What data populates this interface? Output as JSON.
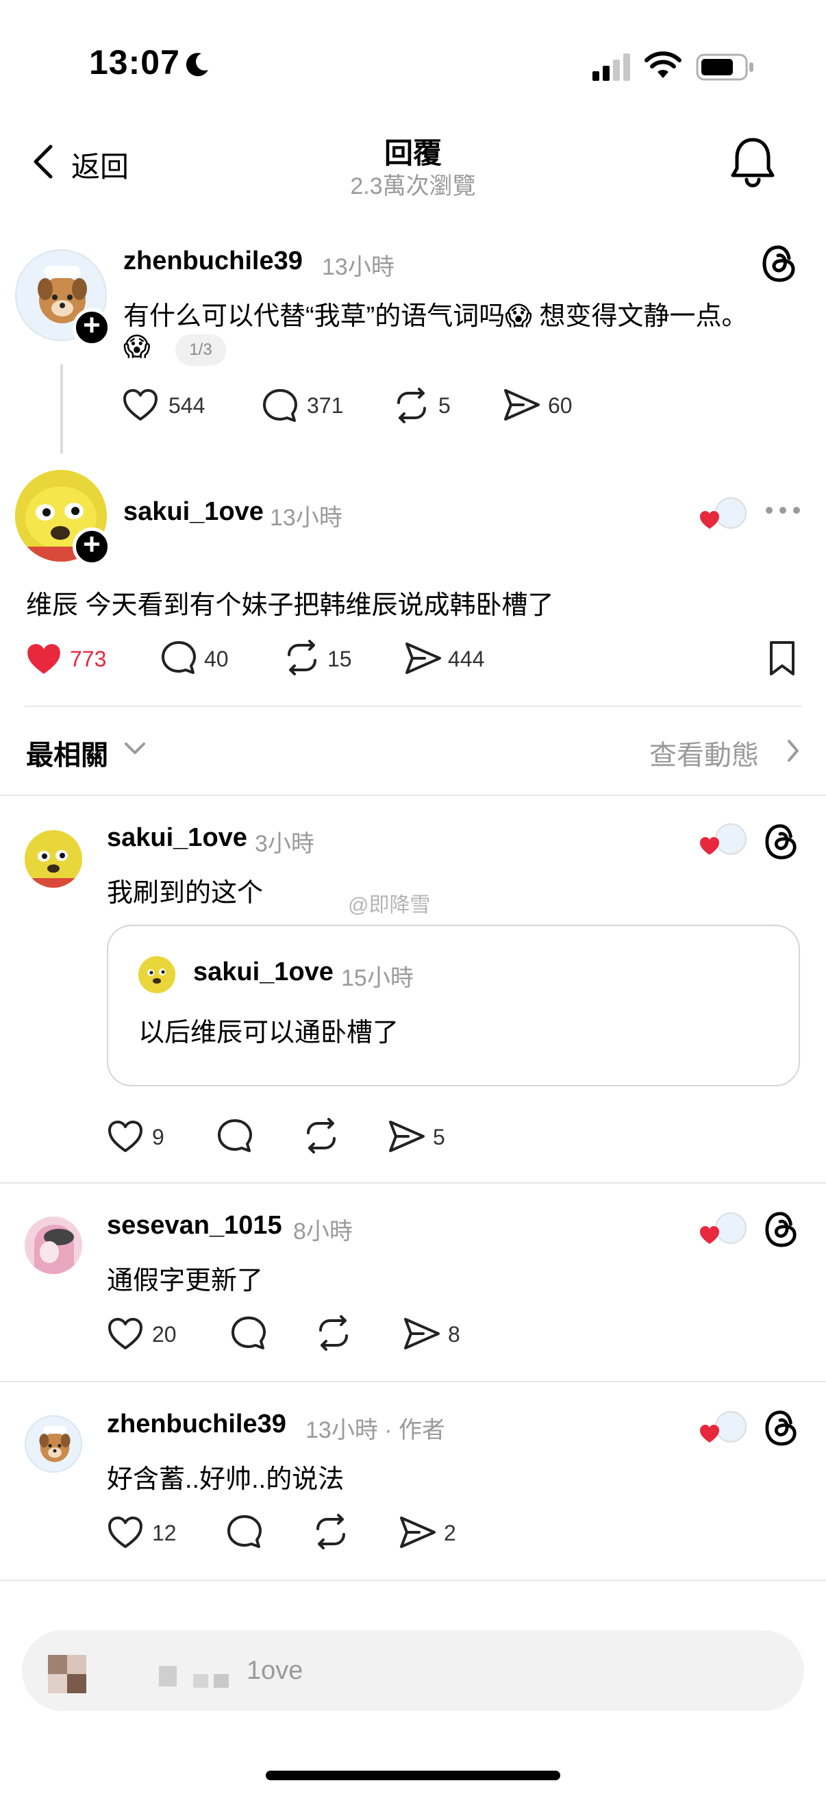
{
  "status_bar": {
    "time": "13:07"
  },
  "header": {
    "back_label": "返回",
    "title": "回覆",
    "subtitle": "2.3萬次瀏覽"
  },
  "original_post": {
    "username": "zhenbuchile39",
    "time": "13小時",
    "text_line1": "有什么可以代替“我草”的语气词吗😱 想变得文静一点。",
    "text_line2_emoji": "😱",
    "page_indicator": "1/3",
    "likes": "544",
    "comments": "371",
    "reposts": "5",
    "shares": "60"
  },
  "main_reply": {
    "username": "sakui_1ove",
    "time": "13小時",
    "text": "维辰 今天看到有个妹子把韩维辰说成韩卧槽了",
    "likes": "773",
    "comments": "40",
    "reposts": "15",
    "shares": "444",
    "liked": true
  },
  "sort_bar": {
    "sort_label": "最相關",
    "activity_label": "查看動態"
  },
  "comments": [
    {
      "username": "sakui_1ove",
      "time": "3小時",
      "text": "我刷到的这个",
      "likes": "9",
      "shares": "5",
      "quote": {
        "username": "sakui_1ove",
        "time": "15小時",
        "text": "以后维辰可以通卧槽了"
      }
    },
    {
      "username": "sesevan_1015",
      "time": "8小時",
      "text": "通假字更新了",
      "likes": "20",
      "shares": "8"
    },
    {
      "username": "zhenbuchile39",
      "time": "13小時 · 作者",
      "text": "好含蓄..好帅..的说法",
      "likes": "12",
      "shares": "2"
    }
  ],
  "watermark": "@即降雪",
  "reply_box": {
    "placeholder": "1ove"
  },
  "colors": {
    "like_red": "#e8283c",
    "muted": "#9a9a9a",
    "divider": "#e6e6e6"
  }
}
